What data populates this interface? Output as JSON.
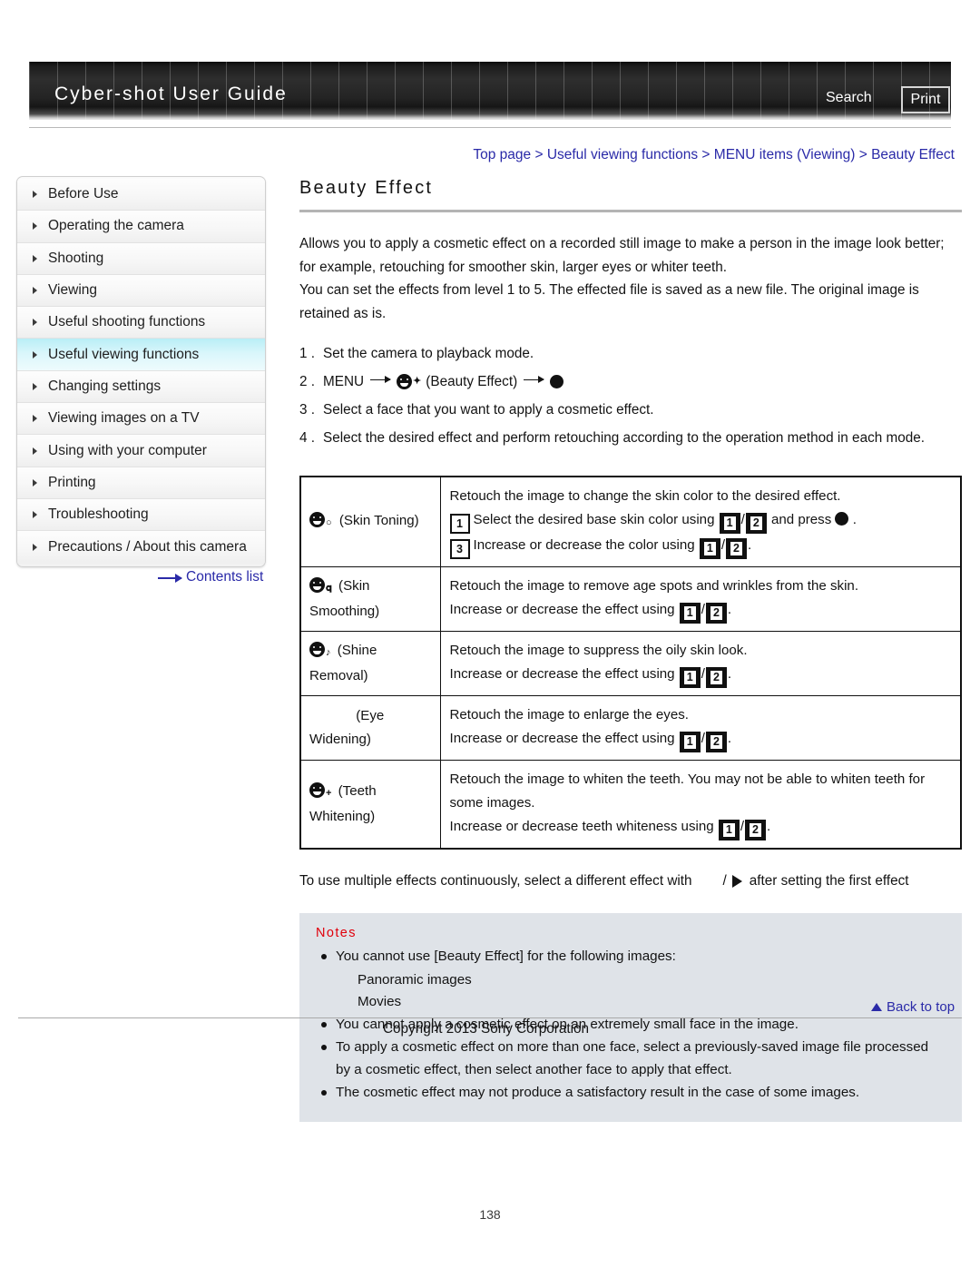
{
  "header": {
    "title": "Cyber-shot User Guide",
    "search_label": "Search",
    "print_label": "Print"
  },
  "breadcrumb": {
    "full": "Top page > Useful viewing functions > MENU items (Viewing) > Beauty Effect",
    "items": [
      "Top page",
      "Useful viewing functions",
      "MENU items (Viewing)",
      "Beauty Effect"
    ],
    "separator": ">",
    "link_color": "#2a2aa8"
  },
  "sidebar": {
    "items": [
      {
        "label": "Before Use",
        "active": false
      },
      {
        "label": "Operating the camera",
        "active": false
      },
      {
        "label": "Shooting",
        "active": false
      },
      {
        "label": "Viewing",
        "active": false
      },
      {
        "label": "Useful shooting functions",
        "active": false
      },
      {
        "label": "Useful viewing functions",
        "active": true
      },
      {
        "label": "Changing settings",
        "active": false
      },
      {
        "label": "Viewing images on a TV",
        "active": false
      },
      {
        "label": "Using with your computer",
        "active": false
      },
      {
        "label": "Printing",
        "active": false
      },
      {
        "label": "Troubleshooting",
        "active": false
      },
      {
        "label": "Precautions / About this camera",
        "active": false
      }
    ],
    "contents_list_label": "Contents list",
    "highlight_color": "#b9eef6"
  },
  "main": {
    "page_title": "Beauty Effect",
    "intro_p1": "Allows you to apply a cosmetic effect on a recorded still image to make a person in the image look better; for example, retouching for smoother skin, larger eyes or whiter teeth.",
    "intro_p2": "You can set the effects from level 1 to 5. The effected file is saved as a new file. The original image is retained as is.",
    "steps": [
      {
        "num": "1 .",
        "text": "Set the camera to playback mode."
      },
      {
        "num": "2 .",
        "menu": "MENU",
        "icon_label": "(Beauty Effect)"
      },
      {
        "num": "3 .",
        "text": "Select a face that you want to apply a cosmetic effect."
      },
      {
        "num": "4 .",
        "text": "Select the desired effect and perform retouching according to the operation method in each mode."
      }
    ],
    "table": {
      "rows": [
        {
          "icon": "face-skin-toning-icon",
          "name": "(Skin Toning)",
          "lines": [
            {
              "step": "",
              "pre": "Retouch the image to change the skin color to the desired effect.",
              "keys": "",
              "post": ""
            },
            {
              "step": "1",
              "pre": "Select the desired base skin color using",
              "keys": "1/2",
              "post": "and press ● ."
            },
            {
              "step": "3",
              "pre": "Increase or decrease the color using",
              "keys": "1/2",
              "post": "."
            }
          ]
        },
        {
          "icon": "face-skin-smoothing-icon",
          "name": "(Skin Smoothing)",
          "lines": [
            {
              "step": "",
              "pre": "Retouch the image to remove age spots and wrinkles from the skin.",
              "keys": "",
              "post": ""
            },
            {
              "step": "",
              "pre": "Increase or decrease the effect using",
              "keys": "1/2",
              "post": "."
            }
          ]
        },
        {
          "icon": "face-shine-removal-icon",
          "name": "(Shine Removal)",
          "lines": [
            {
              "step": "",
              "pre": "Retouch the image to suppress the oily skin look.",
              "keys": "",
              "post": ""
            },
            {
              "step": "",
              "pre": "Increase or decrease the effect using",
              "keys": "1/2",
              "post": "."
            }
          ]
        },
        {
          "icon": "",
          "name": "(Eye Widening)",
          "lines": [
            {
              "step": "",
              "pre": "Retouch the image to enlarge the eyes.",
              "keys": "",
              "post": ""
            },
            {
              "step": "",
              "pre": "Increase or decrease the effect using",
              "keys": "1/2",
              "post": "."
            }
          ]
        },
        {
          "icon": "face-teeth-whitening-icon",
          "name": "(Teeth Whitening)",
          "lines": [
            {
              "step": "",
              "pre": "Retouch the image to whiten the teeth. You may not be able to whiten teeth for some images.",
              "keys": "",
              "post": ""
            },
            {
              "step": "",
              "pre": "Increase or decrease teeth whiteness using",
              "keys": "1/2",
              "post": "."
            }
          ]
        }
      ],
      "cells": {
        "r0c0_name": "(Skin Toning)",
        "r0c1_l1": "Retouch the image to change the skin color to the desired effect.",
        "r0c1_l2_pre": "Select the desired base skin color using",
        "r0c1_l2_post": "and press",
        "r0c1_l2_end": ".",
        "r0c1_l3_pre": "Increase or decrease the color using",
        "r0c1_l3_post": ".",
        "r1c0_name_a": "(Skin",
        "r1c0_name_b": "Smoothing)",
        "r1c1_l1": "Retouch the image to remove age spots and wrinkles from the skin.",
        "r1c1_l2_pre": "Increase or decrease the effect using",
        "r1c1_l2_post": ".",
        "r2c0_name_a": "(Shine",
        "r2c0_name_b": "Removal)",
        "r2c1_l1": "Retouch the image to suppress the oily skin look.",
        "r2c1_l2_pre": "Increase or decrease the effect using",
        "r2c1_l2_post": ".",
        "r3c0_name_a": "(Eye",
        "r3c0_name_b": "Widening)",
        "r3c1_l1": "Retouch the image to enlarge the eyes.",
        "r3c1_l2_pre": "Increase or decrease the effect using",
        "r3c1_l2_post": ".",
        "r4c0_name_a": "(Teeth",
        "r4c0_name_b": "Whitening)",
        "r4c1_l1": "Retouch the image to whiten the teeth. You may not be able to whiten teeth for",
        "r4c1_l1b": "some images.",
        "r4c1_l2_pre": "Increase or decrease teeth whiteness using",
        "r4c1_l2_post": "."
      }
    },
    "multi_effect_pre": "To use multiple effects continuously, select a different effect with",
    "multi_effect_slash": "/",
    "multi_effect_post": "after setting the first effect"
  },
  "notes": {
    "title": "Notes",
    "items": [
      "You cannot use [Beauty Effect] for the following images:",
      "You cannot apply a cosmetic effect on an extremely small face in the image.",
      "To apply a cosmetic effect on more than one face, select a previously-saved image file processed by a cosmetic effect, then select another face to apply that effect.",
      "The cosmetic effect may not produce a satisfactory result in the case of some images."
    ],
    "sub_items": [
      "Panoramic images",
      "Movies"
    ],
    "title_color": "#e0000b",
    "background_color": "#dfe3e8"
  },
  "footer": {
    "back_to_top": "Back to top",
    "copyright": "Copyright 2013 Sony Corporation",
    "page_number": "138"
  },
  "keys": {
    "one": "1",
    "two": "2",
    "three": "3",
    "slash": "/"
  }
}
